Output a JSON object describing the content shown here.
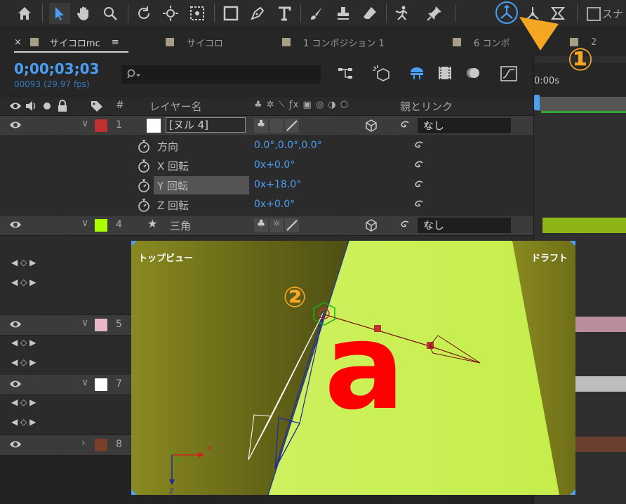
{
  "toolbar": {
    "tools": [
      "home-icon",
      "selection-icon",
      "hand-icon",
      "zoom-icon",
      "rotate-icon",
      "orbit-icon",
      "track-xy-icon",
      "rectangle-icon",
      "pen-icon",
      "text-icon",
      "brush-icon",
      "stamp-icon",
      "eraser-icon",
      "puppet-icon",
      "pin-icon",
      "local-axis-icon",
      "world-axis-icon",
      "view-axis-icon"
    ],
    "snap_label": "スナ"
  },
  "tabs": [
    {
      "label": "サイコロmc",
      "active": true
    },
    {
      "label": "サイコロ"
    },
    {
      "label": "1 コンポジション 1"
    },
    {
      "label": "6 コンポ"
    },
    {
      "label": "2"
    }
  ],
  "timecode": "0;00;03;03",
  "frames": "00093 (29.97 fps)",
  "timeline_start": "0:00s",
  "columns": {
    "name": "レイヤー名",
    "number": "#",
    "parent": "親とリンク"
  },
  "layers": {
    "l1": {
      "num": "1",
      "name": "[ヌル 4]",
      "color": "#c03030",
      "parent": "なし"
    },
    "l4": {
      "num": "4",
      "name": "三角",
      "color": "#aaff00",
      "parent": "なし"
    },
    "l5": {
      "num": "5",
      "color": "#e9b7c6"
    },
    "l7": {
      "num": "7",
      "color": "#ffffff"
    },
    "l8": {
      "num": "8",
      "color": "#7a3e2a"
    }
  },
  "properties": [
    {
      "name": "方向",
      "value": "0.0°,0.0°,0.0°"
    },
    {
      "name": "X 回転",
      "value": "0x+0.0°"
    },
    {
      "name": "Y 回転",
      "value": "0x+18.0°"
    },
    {
      "name": "Z 回転",
      "value": "0x+0.0°"
    }
  ],
  "viewer": {
    "view_label": "トップビュー",
    "draft_label": "ドラフト",
    "glyph": "a"
  },
  "callouts": {
    "one": "①",
    "two": "②"
  },
  "colors": {
    "accent": "#4a9ff5",
    "callout": "#f5a623",
    "glyph": "#ff0000"
  }
}
